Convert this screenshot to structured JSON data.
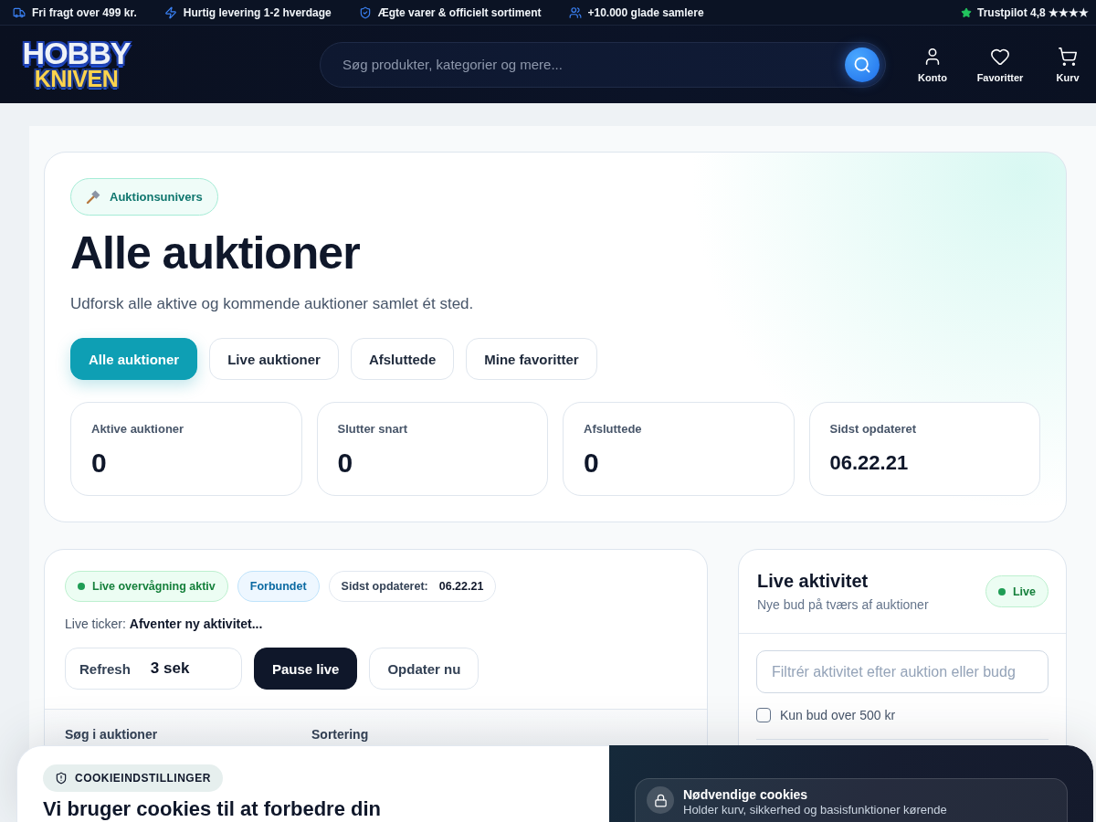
{
  "top_bar": {
    "items": [
      {
        "kind": "truck",
        "text": "Fri fragt over 499 kr."
      },
      {
        "kind": "bolt",
        "text": "Hurtig levering 1-2 hverdage"
      },
      {
        "kind": "shield",
        "text": "Ægte varer & officielt sortiment"
      },
      {
        "kind": "users",
        "text": "+10.000 glade samlere"
      }
    ],
    "rating": {
      "text": "Trustpilot 4,8 ★★★★"
    }
  },
  "header": {
    "logo": {
      "line_1": "HOBBY",
      "line_2": "KNIVEN"
    },
    "search": {
      "placeholder": "Søg produkter, kategorier og mere..."
    },
    "nav": [
      {
        "kind": "user",
        "label": "Konto"
      },
      {
        "kind": "heart",
        "label": "Favoritter"
      },
      {
        "kind": "cart",
        "label": "Kurv"
      }
    ]
  },
  "hero": {
    "badge": "Auktionsunivers",
    "title": "Alle auktioner",
    "subtitle": "Udforsk alle aktive og kommende auktioner samlet ét sted.",
    "tabs": [
      {
        "label": "Alle auktioner",
        "selected": true
      },
      {
        "label": "Live auktioner",
        "selected": false
      },
      {
        "label": "Afsluttede",
        "selected": false
      },
      {
        "label": "Mine favoritter",
        "selected": false
      }
    ],
    "stats": [
      {
        "kind": "count",
        "label": "Aktive auktioner",
        "value": "0"
      },
      {
        "kind": "count",
        "label": "Slutter snart",
        "value": "0"
      },
      {
        "kind": "count",
        "label": "Afsluttede",
        "value": "0"
      },
      {
        "kind": "time",
        "label": "Sidst opdateret",
        "value": "06.22.21"
      }
    ]
  },
  "live_panel": {
    "status_pills": [
      {
        "kind": "live",
        "text": "Live overvågning aktiv"
      },
      {
        "kind": "connected",
        "text": "Forbundet"
      },
      {
        "kind": "updated",
        "text": "Sidst opdateret: **06.22.21**"
      }
    ],
    "ticker": "Live ticker: **Afventer ny aktivitet...**",
    "refresh": {
      "label": "Refresh",
      "value": "3 sek"
    },
    "buttons": [
      {
        "kind": "primary",
        "label": "Pause live"
      },
      {
        "kind": "secondary",
        "label": "Opdater nu"
      }
    ],
    "filters": [
      {
        "label": "Søg i auktioner"
      },
      {
        "label": "Sortering"
      }
    ]
  },
  "activity": {
    "title": "Live aktivitet",
    "subtitle": "Nye bud på tværs af auktioner",
    "badge": "Live",
    "filter": {
      "placeholder": "Filtrér aktivitet efter auktion eller budg"
    },
    "only_high_bids": {
      "label": "Kun bud over 500 kr",
      "checked": false
    }
  },
  "cookie_banner": {
    "badge": "COOKIEINDSTILLINGER",
    "heading": "Vi bruger cookies til at forbedre din",
    "categories": [
      {
        "title": "Nødvendige cookies",
        "description": "Holder kurv, sikkerhed og basisfunktioner kørende"
      }
    ]
  }
}
